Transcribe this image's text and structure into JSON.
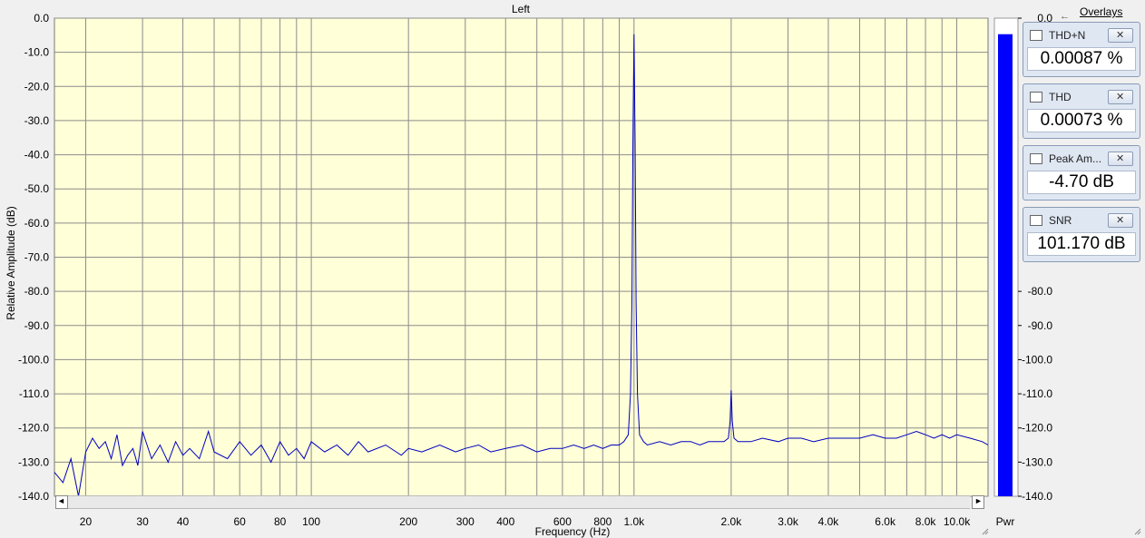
{
  "chart_data": {
    "type": "line",
    "title": "Left",
    "xlabel": "Frequency (Hz)",
    "ylabel": "Relative Amplitude (dB)",
    "x_scale": "log",
    "xlim": [
      16,
      12500
    ],
    "ylim": [
      -140,
      0
    ],
    "grid": true,
    "x_ticks": [
      {
        "v": 20,
        "label": "20"
      },
      {
        "v": 30,
        "label": "30"
      },
      {
        "v": 40,
        "label": "40"
      },
      {
        "v": 60,
        "label": "60"
      },
      {
        "v": 80,
        "label": "80"
      },
      {
        "v": 100,
        "label": "100"
      },
      {
        "v": 200,
        "label": "200"
      },
      {
        "v": 300,
        "label": "300"
      },
      {
        "v": 400,
        "label": "400"
      },
      {
        "v": 600,
        "label": "600"
      },
      {
        "v": 800,
        "label": "800"
      },
      {
        "v": 1000,
        "label": "1.0k"
      },
      {
        "v": 2000,
        "label": "2.0k"
      },
      {
        "v": 3000,
        "label": "3.0k"
      },
      {
        "v": 4000,
        "label": "4.0k"
      },
      {
        "v": 6000,
        "label": "6.0k"
      },
      {
        "v": 8000,
        "label": "8.0k"
      },
      {
        "v": 10000,
        "label": "10.0k"
      }
    ],
    "y_ticks": [
      {
        "v": 0,
        "label": "0.0"
      },
      {
        "v": -10,
        "label": "-10.0"
      },
      {
        "v": -20,
        "label": "-20.0"
      },
      {
        "v": -30,
        "label": "-30.0"
      },
      {
        "v": -40,
        "label": "-40.0"
      },
      {
        "v": -50,
        "label": "-50.0"
      },
      {
        "v": -60,
        "label": "-60.0"
      },
      {
        "v": -70,
        "label": "-70.0"
      },
      {
        "v": -80,
        "label": "-80.0"
      },
      {
        "v": -90,
        "label": "-90.0"
      },
      {
        "v": -100,
        "label": "-100.0"
      },
      {
        "v": -110,
        "label": "-110.0"
      },
      {
        "v": -120,
        "label": "-120.0"
      },
      {
        "v": -130,
        "label": "-130.0"
      },
      {
        "v": -140,
        "label": "-140.0"
      }
    ],
    "series": [
      {
        "color": "#0000c0",
        "points": [
          [
            16,
            -133
          ],
          [
            17,
            -136
          ],
          [
            18,
            -129
          ],
          [
            19,
            -140
          ],
          [
            20,
            -127
          ],
          [
            21,
            -123
          ],
          [
            22,
            -126
          ],
          [
            23,
            -124
          ],
          [
            24,
            -129
          ],
          [
            25,
            -122
          ],
          [
            26,
            -131
          ],
          [
            27,
            -128
          ],
          [
            28,
            -126
          ],
          [
            29,
            -131
          ],
          [
            30,
            -121
          ],
          [
            32,
            -129
          ],
          [
            34,
            -125
          ],
          [
            36,
            -130
          ],
          [
            38,
            -124
          ],
          [
            40,
            -128
          ],
          [
            42,
            -126
          ],
          [
            45,
            -129
          ],
          [
            48,
            -121
          ],
          [
            50,
            -127
          ],
          [
            55,
            -129
          ],
          [
            60,
            -124
          ],
          [
            65,
            -128
          ],
          [
            70,
            -125
          ],
          [
            75,
            -130
          ],
          [
            80,
            -124
          ],
          [
            85,
            -128
          ],
          [
            90,
            -126
          ],
          [
            95,
            -129
          ],
          [
            100,
            -124
          ],
          [
            110,
            -127
          ],
          [
            120,
            -125
          ],
          [
            130,
            -128
          ],
          [
            140,
            -124
          ],
          [
            150,
            -127
          ],
          [
            170,
            -125
          ],
          [
            190,
            -128
          ],
          [
            200,
            -126
          ],
          [
            220,
            -127
          ],
          [
            250,
            -125
          ],
          [
            280,
            -127
          ],
          [
            300,
            -126
          ],
          [
            330,
            -125
          ],
          [
            360,
            -127
          ],
          [
            400,
            -126
          ],
          [
            450,
            -125
          ],
          [
            500,
            -127
          ],
          [
            550,
            -126
          ],
          [
            600,
            -126
          ],
          [
            650,
            -125
          ],
          [
            700,
            -126
          ],
          [
            750,
            -125
          ],
          [
            800,
            -126
          ],
          [
            850,
            -125
          ],
          [
            900,
            -125
          ],
          [
            930,
            -124
          ],
          [
            960,
            -122
          ],
          [
            975,
            -110
          ],
          [
            985,
            -83
          ],
          [
            992,
            -36
          ],
          [
            1000,
            -4.7
          ],
          [
            1008,
            -36
          ],
          [
            1015,
            -83
          ],
          [
            1025,
            -110
          ],
          [
            1040,
            -122
          ],
          [
            1070,
            -124
          ],
          [
            1100,
            -125
          ],
          [
            1200,
            -124
          ],
          [
            1300,
            -125
          ],
          [
            1400,
            -124
          ],
          [
            1500,
            -124
          ],
          [
            1600,
            -125
          ],
          [
            1700,
            -124
          ],
          [
            1800,
            -124
          ],
          [
            1900,
            -124
          ],
          [
            1960,
            -123
          ],
          [
            1985,
            -118
          ],
          [
            2000,
            -109
          ],
          [
            2015,
            -118
          ],
          [
            2040,
            -123
          ],
          [
            2100,
            -124
          ],
          [
            2300,
            -124
          ],
          [
            2500,
            -123
          ],
          [
            2800,
            -124
          ],
          [
            3000,
            -123
          ],
          [
            3300,
            -123
          ],
          [
            3600,
            -124
          ],
          [
            4000,
            -123
          ],
          [
            4500,
            -123
          ],
          [
            5000,
            -123
          ],
          [
            5500,
            -122
          ],
          [
            6000,
            -123
          ],
          [
            6500,
            -123
          ],
          [
            7000,
            -122
          ],
          [
            7500,
            -121
          ],
          [
            8000,
            -122
          ],
          [
            8500,
            -123
          ],
          [
            9000,
            -122
          ],
          [
            9500,
            -123
          ],
          [
            10000,
            -122
          ],
          [
            11000,
            -123
          ],
          [
            12000,
            -124
          ],
          [
            12500,
            -125
          ]
        ]
      }
    ],
    "meter": {
      "label": "Pwr",
      "level_db": -4.7,
      "visible_scale": [
        {
          "v": 0,
          "label": "0.0"
        },
        {
          "v": -80,
          "label": "-80.0"
        },
        {
          "v": -90,
          "label": "-90.0"
        },
        {
          "v": -100,
          "label": "-100.0"
        },
        {
          "v": -110,
          "label": "-110.0"
        },
        {
          "v": -120,
          "label": "-120.0"
        },
        {
          "v": -130,
          "label": "-130.0"
        },
        {
          "v": -140,
          "label": "-140.0"
        }
      ],
      "color": "#0000ff"
    }
  },
  "overlays": {
    "link_label": "Overlays",
    "meters": [
      {
        "label": "THD+N",
        "value": "0.00087 %"
      },
      {
        "label": "THD",
        "value": "0.00073 %"
      },
      {
        "label": "Peak Am...",
        "value": "-4.70 dB"
      },
      {
        "label": "SNR",
        "value": "101.170 dB"
      }
    ]
  },
  "scrollbar": {
    "left_glyph": "◄",
    "right_glyph": "►"
  },
  "colors": {
    "plot_bg": "#ffffd8",
    "grid": "#8c8c8c",
    "trace": "#0000c0",
    "meter_bar": "#0000ff"
  }
}
